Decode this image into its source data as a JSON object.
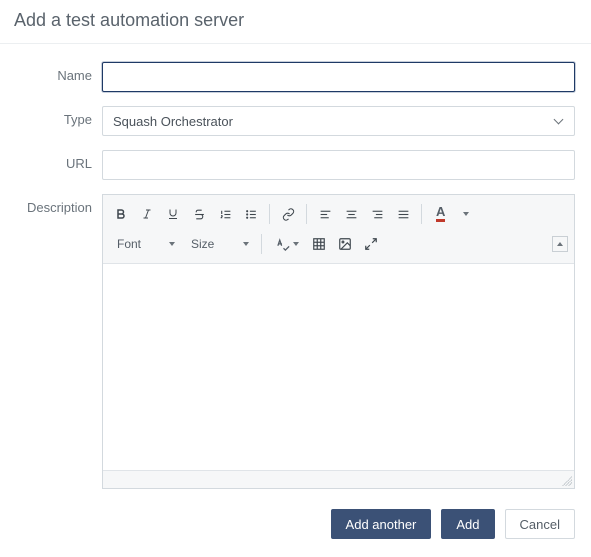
{
  "dialog": {
    "title": "Add a test automation server"
  },
  "fields": {
    "name": {
      "label": "Name",
      "value": ""
    },
    "type": {
      "label": "Type",
      "selected": "Squash Orchestrator"
    },
    "url": {
      "label": "URL",
      "value": ""
    },
    "description": {
      "label": "Description",
      "value": ""
    }
  },
  "editor": {
    "font_label": "Font",
    "size_label": "Size"
  },
  "footer": {
    "add_another": "Add another",
    "add": "Add",
    "cancel": "Cancel"
  }
}
